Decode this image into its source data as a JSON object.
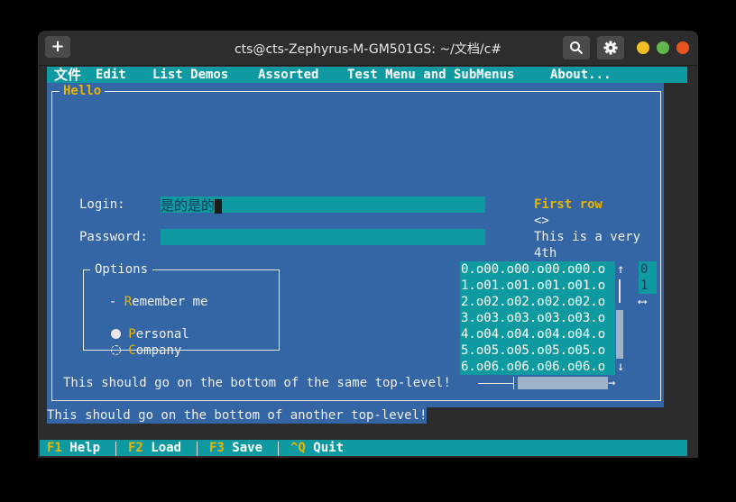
{
  "window": {
    "title": "cts@cts-Zephyrus-M-GM501GS: ~/文档/c#",
    "new_tab": "+",
    "close_color": "#e95420",
    "minimize_color": "#f4bf25",
    "maximize_color": "#62b84a"
  },
  "menu": [
    "文件",
    "Edit",
    "List Demos",
    "Assorted",
    "Test Menu and SubMenus",
    "About..."
  ],
  "hello_frame": {
    "title": "Hello"
  },
  "login": {
    "label": "Login:",
    "value": "是的是的"
  },
  "password": {
    "label": "Password:",
    "value": ""
  },
  "options": {
    "title": "Options",
    "checkbox_mark": "-",
    "checkbox_hot": "R",
    "checkbox_rest": "emember me",
    "radio1_hot": "P",
    "radio1_rest": "ersonal",
    "radio2_hot": "C",
    "radio2_rest": "ompany"
  },
  "list": {
    "first_row": "First row",
    "angle": "<>",
    "long_text": "This is a very",
    "fourth": "4th"
  },
  "listview_rows": [
    "0.o00.o00.o00.o00.o",
    "1.o01.o01.o01.o01.o",
    "2.o02.o02.o02.o02.o",
    "3.o03.o03.o03.o03.o",
    "4.o04.o04.o04.o04.o",
    "5.o05.o05.o05.o05.o",
    "6.o06.o06.o06.o06.o"
  ],
  "side_list": [
    "0",
    "1"
  ],
  "arrows": {
    "up": "↑",
    "down": "↓",
    "right": "→",
    "leftright": "⟷"
  },
  "bottom_same": "This should go on the bottom of the same top-level!",
  "bottom_another": "This should go on the bottom of another top-level!",
  "statusbar": [
    {
      "key": "F1",
      "label": "Help"
    },
    {
      "key": "F2",
      "label": "Load"
    },
    {
      "key": "F3",
      "label": "Save"
    },
    {
      "key": "^Q",
      "label": "Quit"
    }
  ]
}
